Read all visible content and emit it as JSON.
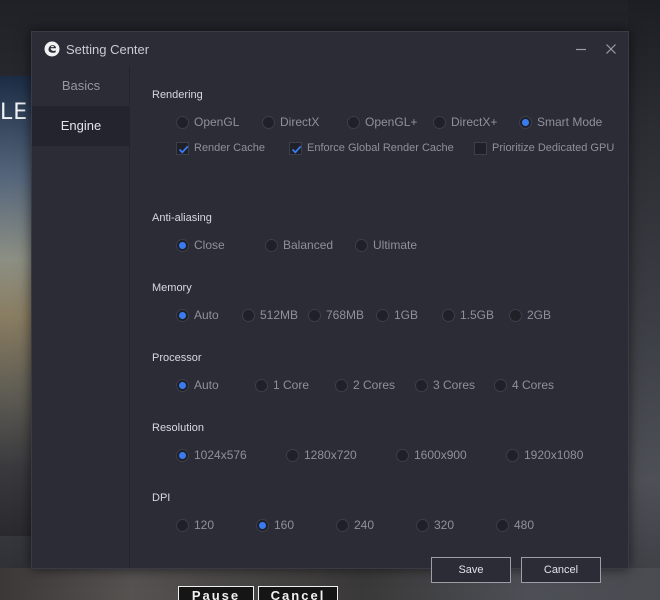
{
  "background": {
    "text": "LE",
    "buttons": [
      "Pause",
      "Cancel"
    ]
  },
  "window": {
    "title": "Setting Center",
    "minimize_icon": "minimize-icon",
    "close_icon": "close-icon"
  },
  "sidebar": {
    "items": [
      {
        "label": "Basics",
        "active": false
      },
      {
        "label": "Engine",
        "active": true
      }
    ]
  },
  "rendering": {
    "title": "Rendering",
    "options": [
      "OpenGL",
      "DirectX",
      "OpenGL+",
      "DirectX+",
      "Smart Mode"
    ],
    "selected": "Smart Mode",
    "checkboxes": [
      {
        "label": "Render Cache",
        "checked": true
      },
      {
        "label": "Enforce Global Render Cache",
        "checked": true
      },
      {
        "label": "Prioritize Dedicated GPU",
        "checked": false
      }
    ]
  },
  "antialiasing": {
    "title": "Anti-aliasing",
    "options": [
      "Close",
      "Balanced",
      "Ultimate"
    ],
    "selected": "Close"
  },
  "memory": {
    "title": "Memory",
    "options": [
      "Auto",
      "512MB",
      "768MB",
      "1GB",
      "1.5GB",
      "2GB"
    ],
    "selected": "Auto"
  },
  "processor": {
    "title": "Processor",
    "options": [
      "Auto",
      "1 Core",
      "2 Cores",
      "3 Cores",
      "4 Cores"
    ],
    "selected": "Auto"
  },
  "resolution": {
    "title": "Resolution",
    "options": [
      "1024x576",
      "1280x720",
      "1600x900",
      "1920x1080"
    ],
    "selected": "1024x576"
  },
  "dpi": {
    "title": "DPI",
    "options": [
      "120",
      "160",
      "240",
      "320",
      "480"
    ],
    "selected": "160"
  },
  "actions": {
    "save_label": "Save",
    "cancel_label": "Cancel"
  },
  "colors": {
    "accent": "#3a7cf0",
    "window_bg": "#2b2c36",
    "sidebar_active_bg": "#23242d"
  }
}
